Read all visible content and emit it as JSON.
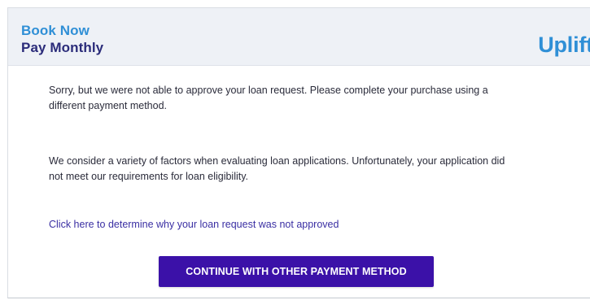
{
  "header": {
    "brand_line1": "Book Now",
    "brand_line2": "Pay Monthly",
    "logo_text": "Uplift"
  },
  "message": {
    "paragraph1": "Sorry, but we were not able to approve your loan request. Please complete your purchase using a different payment method.",
    "paragraph2": "We consider a variety of factors when evaluating loan applications. Unfortunately, your application did not meet our requirements for loan eligibility.",
    "link_text": "Click here to determine why your loan request was not approved"
  },
  "actions": {
    "continue_label": "CONTINUE WITH OTHER PAYMENT METHOD"
  },
  "colors": {
    "brand_blue": "#2f8fd6",
    "brand_navy": "#2b2c7a",
    "button_purple": "#3b11a8",
    "link_purple": "#3a2fa3",
    "header_bg": "#eef1f6"
  }
}
